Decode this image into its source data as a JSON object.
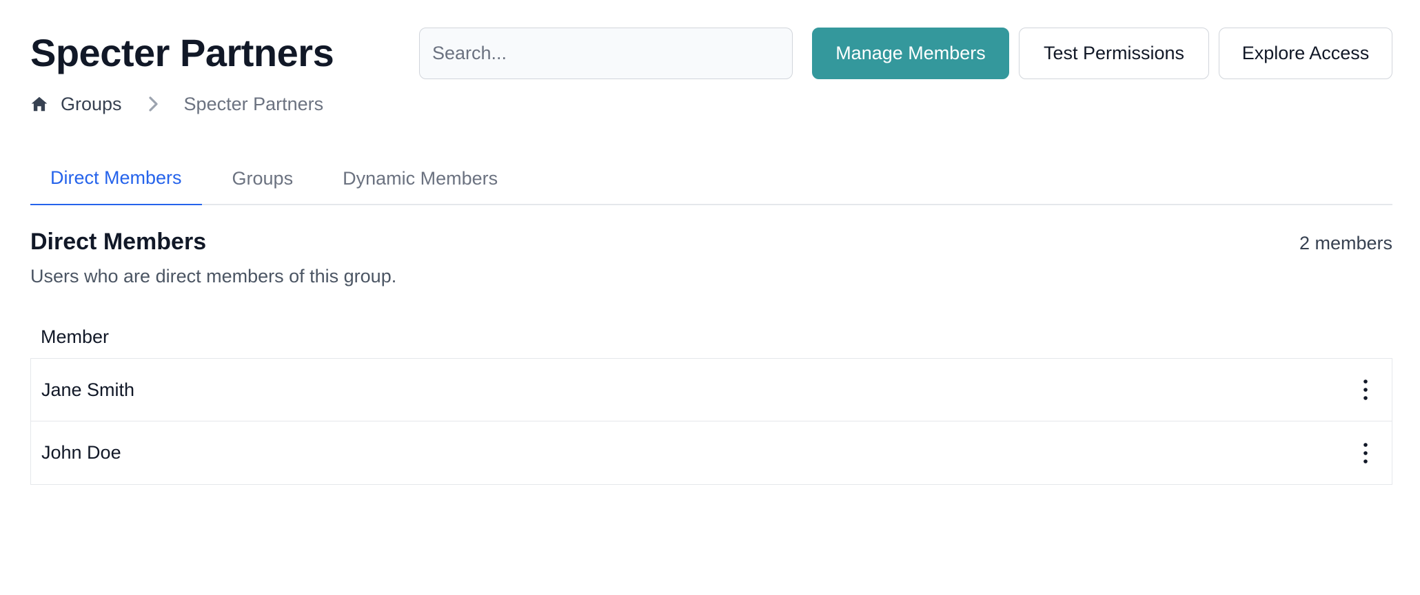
{
  "header": {
    "title": "Specter Partners",
    "search_placeholder": "Search...",
    "buttons": {
      "manage_members": "Manage Members",
      "test_permissions": "Test Permissions",
      "explore_access": "Explore Access"
    }
  },
  "breadcrumb": {
    "items": [
      "Groups",
      "Specter Partners"
    ]
  },
  "tabs": [
    {
      "label": "Direct Members",
      "active": true
    },
    {
      "label": "Groups",
      "active": false
    },
    {
      "label": "Dynamic Members",
      "active": false
    }
  ],
  "section": {
    "title": "Direct Members",
    "count": "2 members",
    "description": "Users who are direct members of this group."
  },
  "table": {
    "columns": [
      "Member"
    ],
    "rows": [
      {
        "name": "Jane Smith"
      },
      {
        "name": "John Doe"
      }
    ]
  },
  "colors": {
    "primary": "#34989c",
    "tab_active": "#2563eb",
    "border": "#e5e7eb"
  },
  "icons": {
    "home": "home-icon",
    "chevron": "chevron-right-icon",
    "row_menu": "more-vertical-icon"
  }
}
